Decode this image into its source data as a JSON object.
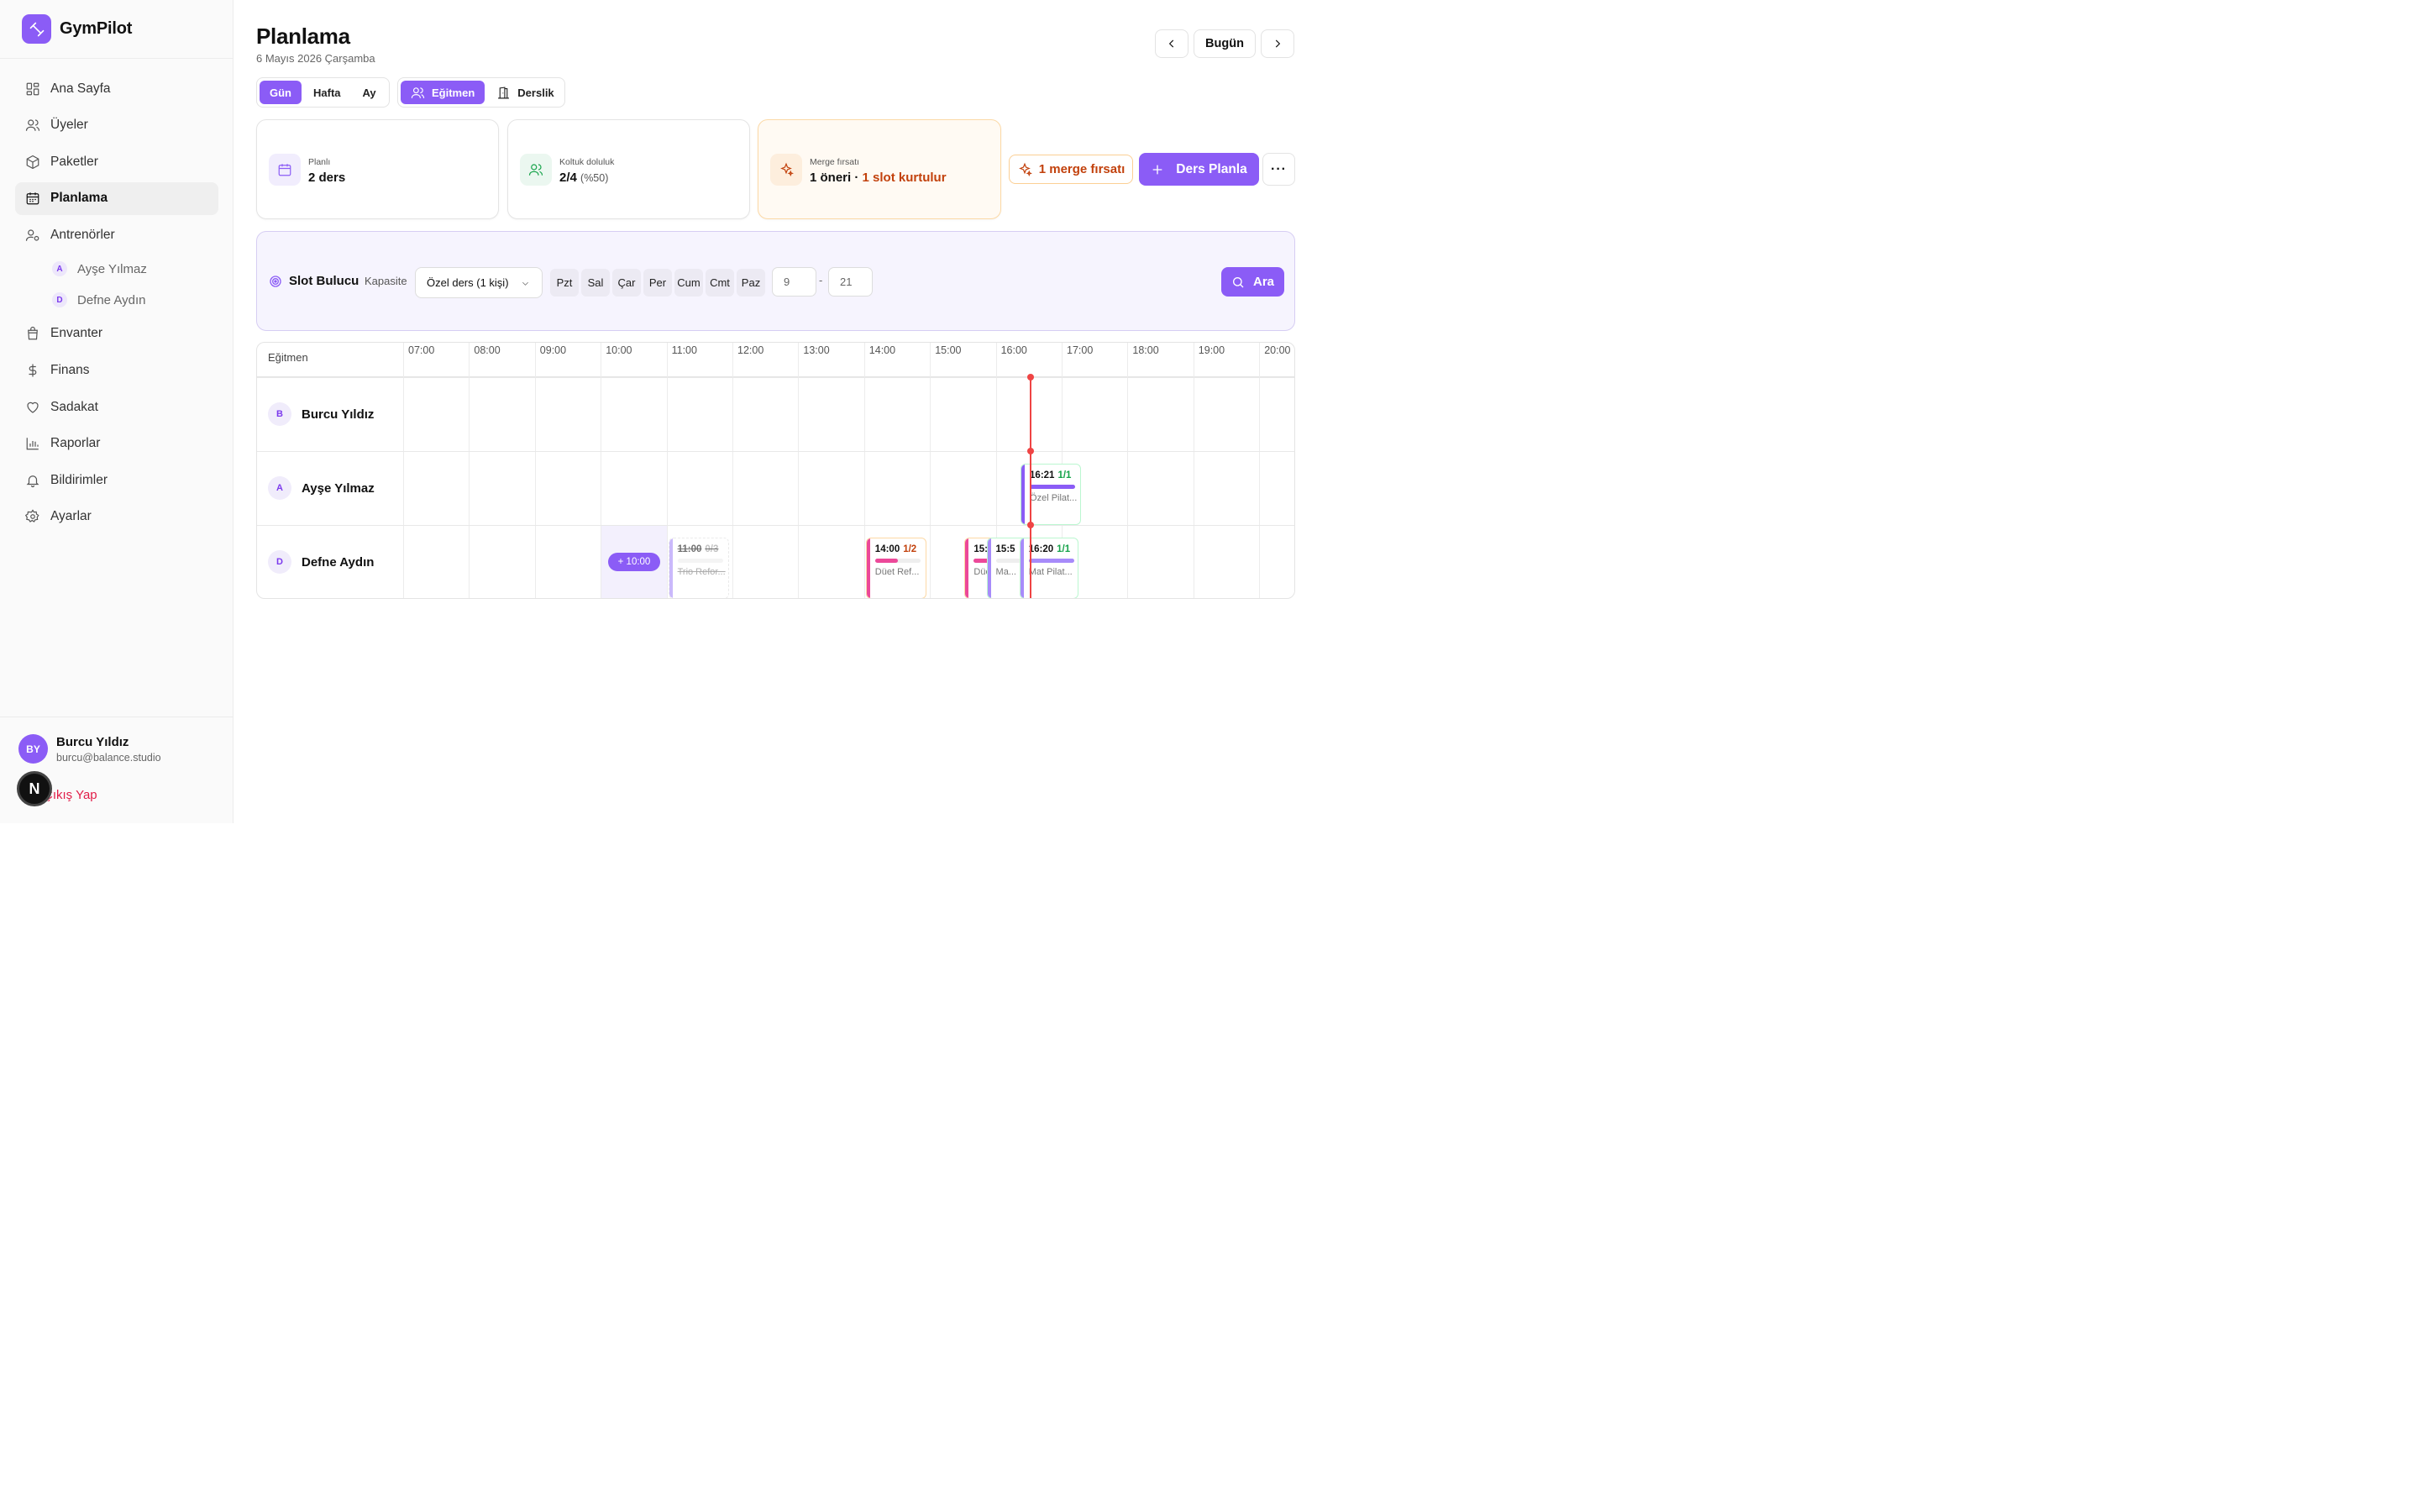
{
  "app": {
    "name": "GymPilot"
  },
  "sidebar": {
    "items": [
      {
        "label": "Ana Sayfa",
        "icon": "grid-icon"
      },
      {
        "label": "Üyeler",
        "icon": "users-icon"
      },
      {
        "label": "Paketler",
        "icon": "package-icon"
      },
      {
        "label": "Planlama",
        "icon": "calendar-icon",
        "active": true
      },
      {
        "label": "Antrenörler",
        "icon": "user-cog-icon"
      },
      {
        "label": "Envanter",
        "icon": "bag-icon"
      },
      {
        "label": "Finans",
        "icon": "dollar-icon"
      },
      {
        "label": "Sadakat",
        "icon": "heart-icon"
      },
      {
        "label": "Raporlar",
        "icon": "bar-chart-icon"
      },
      {
        "label": "Bildirimler",
        "icon": "bell-icon"
      },
      {
        "label": "Ayarlar",
        "icon": "gear-icon"
      }
    ],
    "trainers": [
      {
        "initial": "A",
        "name": "Ayşe Yılmaz"
      },
      {
        "initial": "D",
        "name": "Defne Aydın"
      }
    ],
    "user": {
      "initials": "BY",
      "name": "Burcu Yıldız",
      "email": "burcu@balance.studio"
    },
    "logout": "Çıkış Yap",
    "dev_badge": "N"
  },
  "header": {
    "title": "Planlama",
    "date": "6 Mayıs 2026 Çarşamba",
    "today_button": "Bugün"
  },
  "view_toggle": {
    "day": "Gün",
    "week": "Hafta",
    "month": "Ay",
    "selected": "Gün"
  },
  "group_toggle": {
    "trainer": "Eğitmen",
    "room": "Derslik",
    "selected": "Eğitmen"
  },
  "stats": {
    "planned": {
      "label": "Planlı",
      "value": "2 ders"
    },
    "occupancy": {
      "label": "Koltuk doluluk",
      "value": "2/4",
      "percent": "(%50)"
    },
    "merge": {
      "label": "Merge fırsatı",
      "value": "1 öneri ·",
      "highlight": "1 slot kurtulur"
    }
  },
  "actions": {
    "merge_button": "1 merge fırsatı",
    "plan_button": "Ders Planla",
    "more": "···"
  },
  "slot_finder": {
    "title": "Slot Bulucu",
    "capacity_label": "Kapasite",
    "capacity_value": "Özel ders (1 kişi)",
    "days": [
      "Pzt",
      "Sal",
      "Çar",
      "Per",
      "Cum",
      "Cmt",
      "Paz"
    ],
    "from_hour": "9",
    "to_hour": "21",
    "separator": "-",
    "search_button": "Ara"
  },
  "schedule": {
    "column_label": "Eğitmen",
    "hours": [
      "07:00",
      "08:00",
      "09:00",
      "10:00",
      "11:00",
      "12:00",
      "13:00",
      "14:00",
      "15:00",
      "16:00",
      "17:00",
      "18:00",
      "19:00",
      "20:00"
    ],
    "trainers": [
      {
        "initial": "B",
        "name": "Burcu Yıldız"
      },
      {
        "initial": "A",
        "name": "Ayşe Yılmaz"
      },
      {
        "initial": "D",
        "name": "Defne Aydın"
      }
    ],
    "add_slot": "+ 10:00",
    "events": [
      {
        "row": 2,
        "start": "11:00",
        "count": "0/3",
        "name": "Trio Refor...",
        "cancelled": true,
        "color": "#a78bfa",
        "fill": 0
      },
      {
        "row": 2,
        "start": "14:00",
        "count": "1/2",
        "name": "Düet Ref...",
        "color": "#ec4899",
        "fill": 0.5
      },
      {
        "row": 2,
        "start": "15:30",
        "count": "",
        "name": "Düet Re...",
        "color": "#ec4899",
        "fill": 0.5
      },
      {
        "row": 2,
        "start": "15:5",
        "count": "",
        "name": "Ma...",
        "color": "#a78bfa",
        "fill": 0
      },
      {
        "row": 2,
        "start": "16:20",
        "count": "1/1",
        "name": "Mat Pilat...",
        "color": "#a78bfa",
        "fill": 1
      },
      {
        "row": 1,
        "start": "16:21",
        "count": "1/1",
        "name": "Özel Pilat...",
        "color": "#8b5cf6",
        "fill": 1
      }
    ]
  },
  "colors": {
    "accent": "#8b5cf6",
    "now_line": "#ef4444",
    "merge_orange": "#c2410c"
  }
}
